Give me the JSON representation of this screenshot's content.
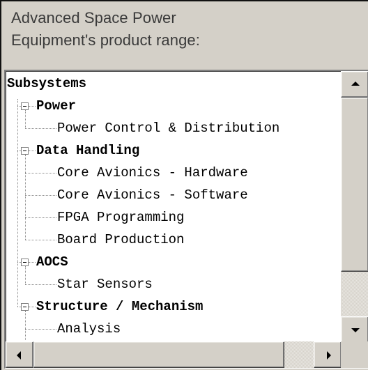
{
  "heading": {
    "line1": "Advanced Space Power",
    "line2": "Equipment's product range:"
  },
  "tree": {
    "root": "Subsystems",
    "groups": [
      {
        "label": "Power",
        "children": [
          "Power Control & Distribution"
        ]
      },
      {
        "label": "Data Handling",
        "children": [
          "Core Avionics - Hardware",
          "Core Avionics - Software",
          "FPGA Programming",
          "Board Production"
        ]
      },
      {
        "label": "AOCS",
        "children": [
          "Star Sensors"
        ]
      },
      {
        "label": "Structure / Mechanism",
        "children": [
          "Analysis"
        ]
      }
    ]
  },
  "icons": {
    "expander": "minus-box-icon",
    "scroll_up": "triangle-up-icon",
    "scroll_down": "triangle-down-icon",
    "scroll_left": "triangle-left-icon",
    "scroll_right": "triangle-right-icon"
  },
  "colors": {
    "panel": "#d4d0c8",
    "tree_background": "#ffffff",
    "heading_text": "#3a3a3a"
  }
}
